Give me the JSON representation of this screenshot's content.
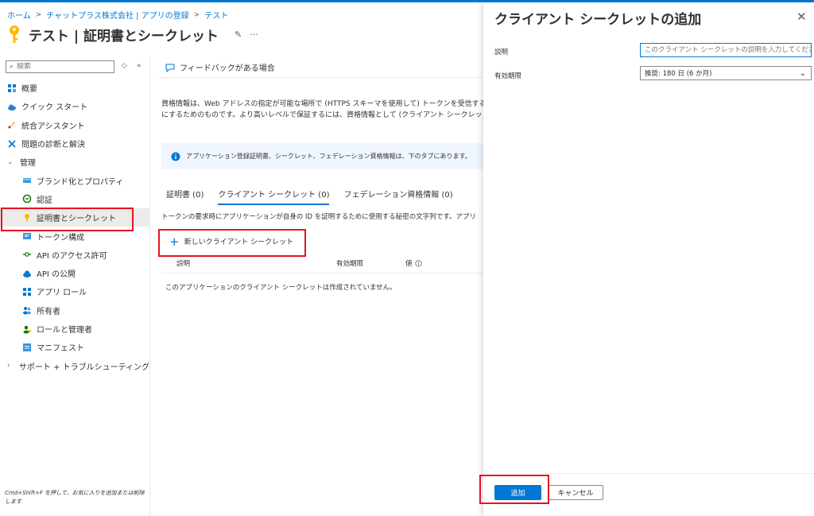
{
  "breadcrumb": [
    "ホーム",
    "チャットプラス株式会社 | アプリの登録",
    "テスト"
  ],
  "page_title": "テスト | 証明書とシークレット",
  "sidebar": {
    "search_placeholder": "検索",
    "items": [
      {
        "label": "概要",
        "icon": "grid-icon"
      },
      {
        "label": "クイック スタート",
        "icon": "cloud-icon"
      },
      {
        "label": "統合アシスタント",
        "icon": "rocket-icon"
      },
      {
        "label": "問題の診断と解決",
        "icon": "wrench-icon"
      },
      {
        "label": "管理",
        "icon": "chevron-down-icon"
      },
      {
        "label": "ブランド化とプロパティ",
        "icon": "card-icon"
      },
      {
        "label": "認証",
        "icon": "auth-icon"
      },
      {
        "label": "証明書とシークレット",
        "icon": "key-icon"
      },
      {
        "label": "トークン構成",
        "icon": "token-icon"
      },
      {
        "label": "API のアクセス許可",
        "icon": "api-permission-icon"
      },
      {
        "label": "API の公開",
        "icon": "cloud-api-icon"
      },
      {
        "label": "アプリ ロール",
        "icon": "app-role-icon"
      },
      {
        "label": "所有者",
        "icon": "owners-icon"
      },
      {
        "label": "ロールと管理者",
        "icon": "roles-admin-icon"
      },
      {
        "label": "マニフェスト",
        "icon": "manifest-icon"
      },
      {
        "label": "サポート + トラブルシューティング",
        "icon": "chevron-right-icon"
      }
    ],
    "footer_hint": "Cmd+Shift+F を押して、お気に入りを追加または削除します"
  },
  "main": {
    "feedback": "フィードバックがある場合",
    "description_line1": "資格情報は、Web アドレスの指定が可能な場所で (HTTPS スキーマを使用して) トークンを受信する際",
    "description_line2": "にするためのものです。より高いレベルで保証するには、資格情報として (クライアント シークレットでは",
    "info": "アプリケーション登録証明書、シークレット、フェデレーション資格情報は、下のタブにあります。",
    "tabs": [
      "証明書 (0)",
      "クライアント シークレット (0)",
      "フェデレーション資格情報 (0)"
    ],
    "tab_description": "トークンの要求時にアプリケーションが自身の ID を証明するために使用する秘密の文字列です。アプリ",
    "new_secret": "新しいクライアント シークレット",
    "columns": [
      "説明",
      "有効期限",
      "値"
    ],
    "empty_message": "このアプリケーションのクライアント シークレットは作成されていません。"
  },
  "panel": {
    "title": "クライアント シークレットの追加",
    "description_label": "説明",
    "description_placeholder": "このクライアント シークレットの説明を入力してくださ",
    "expiry_label": "有効期限",
    "expiry_value": "推奨: 180 日 (6 か月)",
    "add_button": "追加",
    "cancel_button": "キャンセル"
  },
  "colors": {
    "accent": "#0078d4",
    "highlight": "#e81123"
  }
}
